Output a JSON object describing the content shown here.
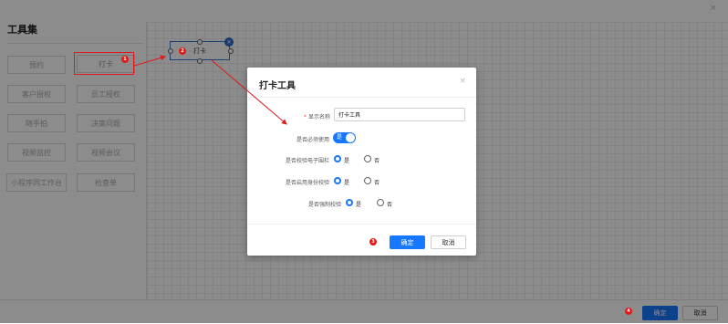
{
  "toolset": {
    "title": "工具集",
    "tools": [
      "预约",
      "打卡",
      "客户授权",
      "员工授权",
      "随手拍",
      "决策问题",
      "视频监控",
      "视频会议",
      "小程序同工作台",
      "检查单"
    ]
  },
  "canvas": {
    "card_label": "打卡",
    "card_close_glyph": "×"
  },
  "modal": {
    "title": "打卡工具",
    "close_glyph": "×",
    "fields": {
      "display_name_label": "显示名称",
      "display_name_value": "打卡工具",
      "required_label": "是否必须使用",
      "required_toggle_text": "是",
      "fence_label": "是否校验电子围栏",
      "identity_label": "是否启用身份校验",
      "force_label": "是否强制校验"
    },
    "radio_yes": "是",
    "radio_no": "否",
    "confirm": "确定",
    "cancel": "取消"
  },
  "footer": {
    "confirm": "确定",
    "cancel": "取消"
  },
  "page_close_glyph": "×",
  "markers": [
    "1",
    "2",
    "3",
    "4"
  ],
  "colors": {
    "primary": "#1677ff",
    "marker": "#e01a1a",
    "card_border": "#3a78d6"
  }
}
